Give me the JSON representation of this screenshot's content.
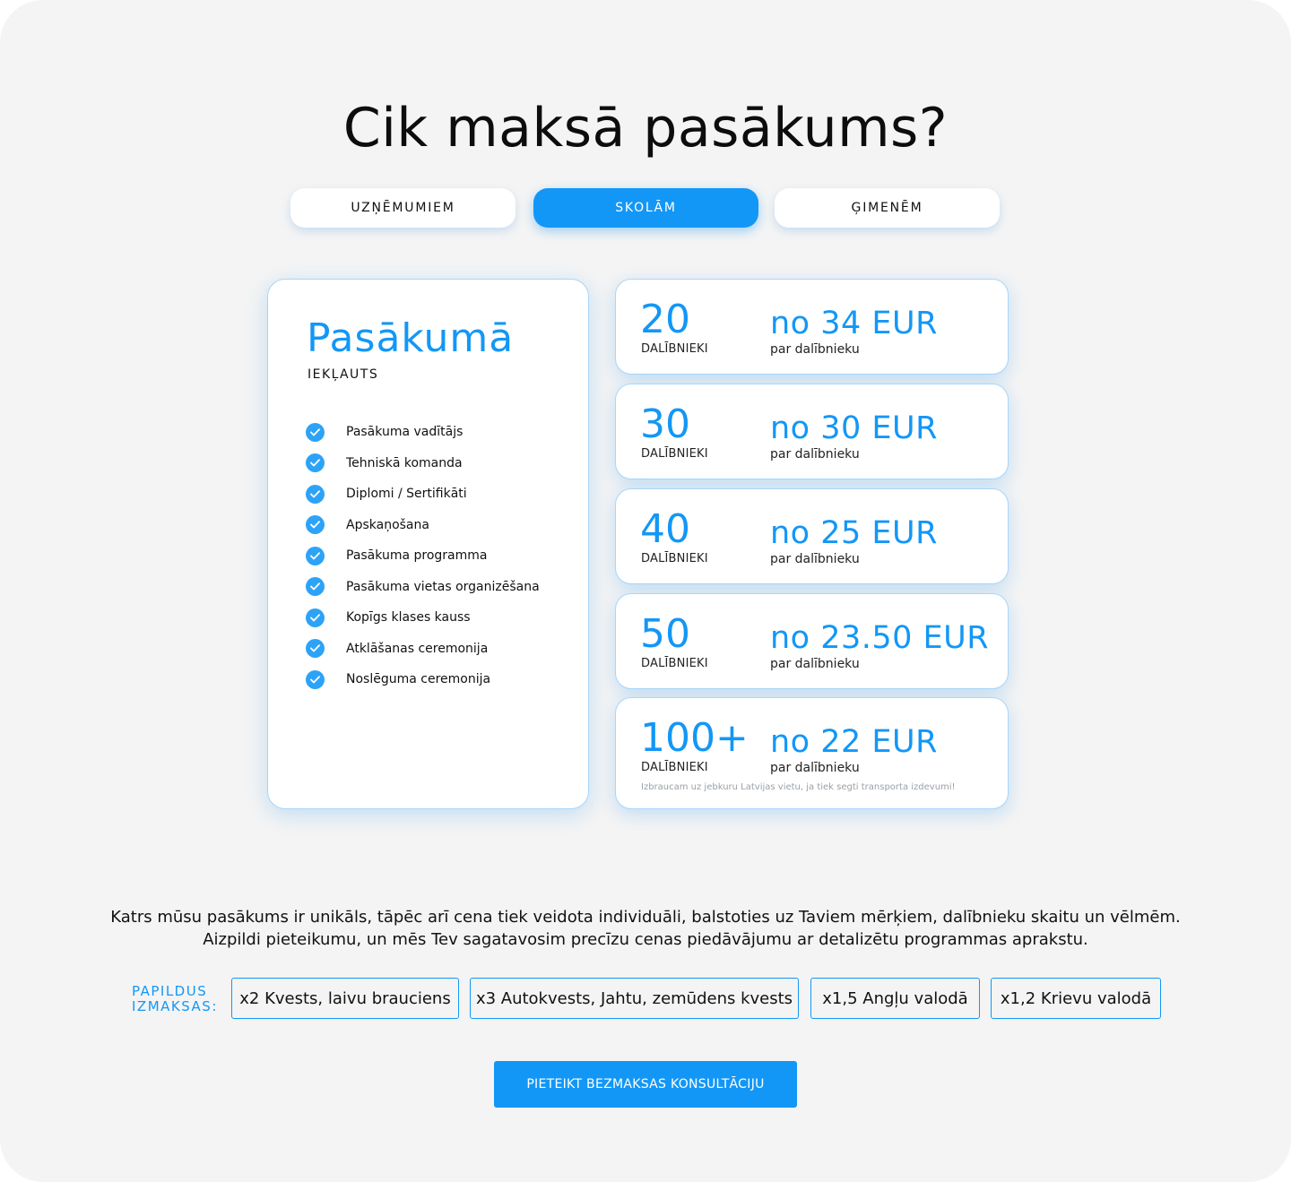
{
  "header": {
    "title": "Cik maksā pasākums?"
  },
  "tabs": [
    {
      "label": "UZŅĒMUMIEM",
      "active": false
    },
    {
      "label": "SKOLĀM",
      "active": true
    },
    {
      "label": "ĢIMENĒM",
      "active": false
    }
  ],
  "included": {
    "title": "Pasākumā",
    "subtitle": "IEKĻAUTS",
    "check_icon": "check-icon",
    "items": [
      "Pasākuma vadītājs",
      "Tehniskā komanda",
      "Diplomi / Sertifikāti",
      "Apskaņošana",
      "Pasākuma programma",
      "Pasākuma vietas organizēšana",
      "Kopīgs klases kauss",
      "Atklāšanas ceremonija",
      "Noslēguma ceremonija"
    ]
  },
  "prices": [
    {
      "count": "20",
      "count_label": "DALĪBNIEKI",
      "amount": "no 34 EUR",
      "amount_label": "par dalībnieku"
    },
    {
      "count": "30",
      "count_label": "DALĪBNIEKI",
      "amount": "no 30 EUR",
      "amount_label": "par dalībnieku"
    },
    {
      "count": "40",
      "count_label": "DALĪBNIEKI",
      "amount": "no 25 EUR",
      "amount_label": "par dalībnieku"
    },
    {
      "count": "50",
      "count_label": "DALĪBNIEKI",
      "amount": "no 23.50 EUR",
      "amount_label": "par dalībnieku"
    },
    {
      "count": "100+",
      "count_label": "DALĪBNIEKI",
      "amount": "no 22 EUR",
      "amount_label": "par dalībnieku",
      "note": "Izbraucam uz jebkuru Latvijas vietu, ja tiek segti transporta izdevumi!"
    }
  ],
  "description": {
    "line1": "Katrs mūsu pasākums ir unikāls, tāpēc arī cena tiek veidota individuāli, balstoties uz Taviem mērķiem, dalībnieku skaitu un vēlmēm.",
    "line2": "Aizpildi pieteikumu, un mēs Tev sagatavosim precīzu cenas piedāvājumu ar detalizētu programmas aprakstu."
  },
  "extras": {
    "label_line1": "PAPILDUS",
    "label_line2": "IZMAKSAS:",
    "items": [
      "x2 Kvests, laivu brauciens",
      "x3 Autokvests, Jahtu, zemūdens kvests",
      "x1,5 Angļu valodā",
      "x1,2 Krievu valodā"
    ]
  },
  "cta": {
    "label": "PIETEIKT BEZMAKSAS KONSULTĀCIJU"
  },
  "colors": {
    "accent": "#1397f6",
    "background": "#f4f4f4",
    "card_border": "#a8d6fb"
  }
}
